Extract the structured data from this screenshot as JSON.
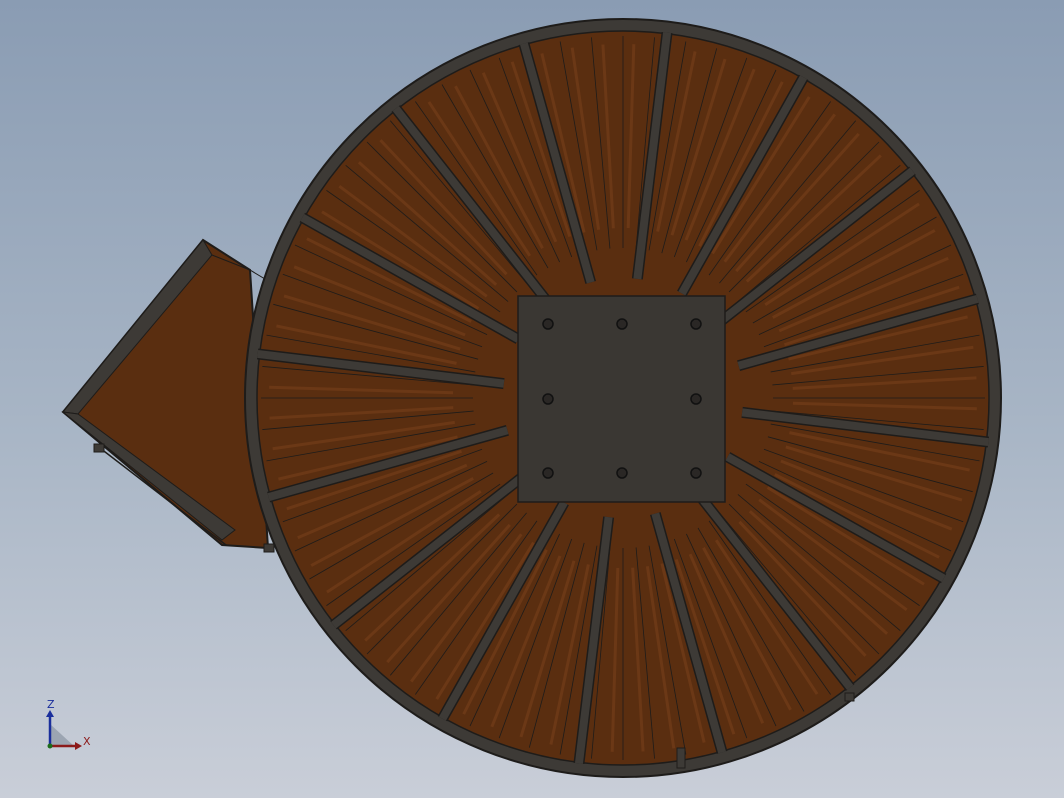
{
  "viewport": {
    "background_top": "#8a9cb3",
    "background_bottom": "#c9ced8"
  },
  "model": {
    "name": "round-rotary-table-with-chute",
    "colors": {
      "wood": "#5a2e10",
      "wood_slat": "#6b3816",
      "steel": "#3d3a36",
      "steel_edge": "#1e1c1a",
      "plate": "#3a3733"
    },
    "mounting_plate_holes": 8
  },
  "triad": {
    "z_label": "Z",
    "x_label": "X",
    "z_color": "#1a2e9c",
    "x_color": "#8c1a1a"
  }
}
